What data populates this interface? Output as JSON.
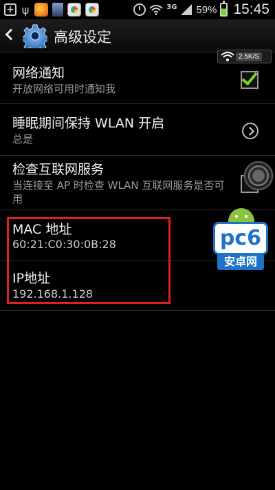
{
  "status_bar": {
    "icons_left": [
      "plus-icon",
      "usb-icon",
      "app-icon",
      "app-icon",
      "app-icon",
      "app-icon"
    ],
    "network_type": "3G",
    "battery_percent": "59%",
    "time": "15:45"
  },
  "action_bar": {
    "title": "高级设定",
    "speed": "2.5K/S"
  },
  "settings": [
    {
      "title": "网络通知",
      "subtitle": "开放网络可用时通知我",
      "control": "checkbox",
      "checked": true
    },
    {
      "title": "睡眠期间保持 WLAN 开启",
      "subtitle": "总是",
      "control": "arrow"
    },
    {
      "title": "检查互联网服务",
      "subtitle": "当连接至 AP 时检查 WLAN 互联网服务是否可用",
      "control": "checkbox",
      "checked": false
    },
    {
      "title": "MAC 地址",
      "subtitle": "60:21:C0:30:0B:28"
    },
    {
      "title": "IP地址",
      "subtitle": "192.168.1.128"
    }
  ],
  "watermark": {
    "brand": "pc6",
    "tagline": "安卓网"
  },
  "colors": {
    "accent_green": "#7ed321",
    "highlight_red": "#e02020",
    "watermark_blue": "#1e73c8"
  }
}
